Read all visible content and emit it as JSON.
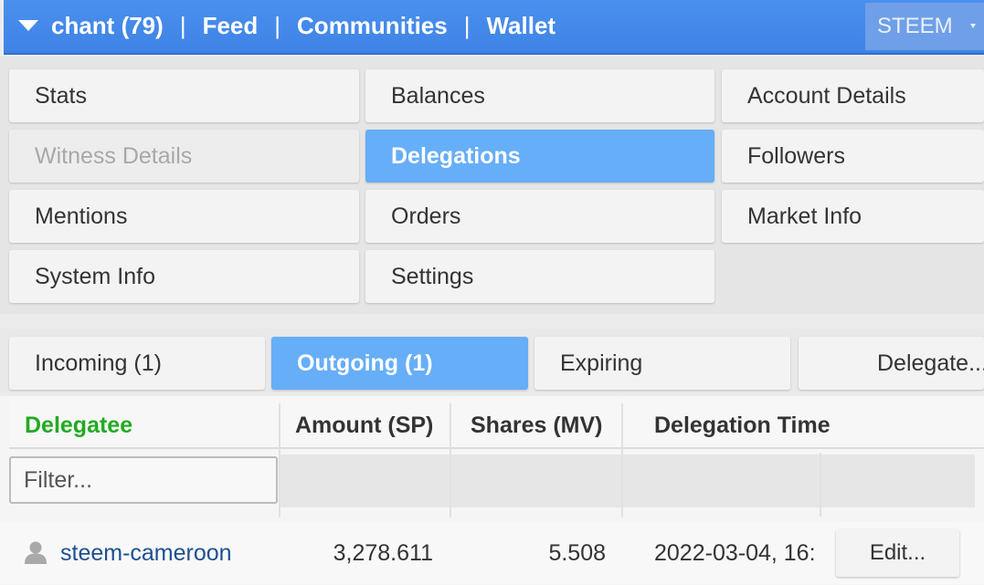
{
  "topbar": {
    "nav": {
      "account": "chant (79)",
      "feed": "Feed",
      "communities": "Communities",
      "wallet": "Wallet",
      "separator": "|"
    },
    "currency": "STEEM"
  },
  "menu": {
    "stats": "Stats",
    "balances": "Balances",
    "account_details": "Account Details",
    "witness_details": "Witness Details",
    "delegations": "Delegations",
    "followers": "Followers",
    "mentions": "Mentions",
    "orders": "Orders",
    "market_info": "Market Info",
    "system_info": "System Info",
    "settings": "Settings"
  },
  "subtabs": {
    "incoming": "Incoming (1)",
    "outgoing": "Outgoing (1)",
    "expiring": "Expiring",
    "delegate": "Delegate..."
  },
  "table": {
    "headers": {
      "delegatee": "Delegatee",
      "amount": "Amount (SP)",
      "shares": "Shares (MV)",
      "time": "Delegation Time"
    },
    "filter_placeholder": "Filter...",
    "rows": [
      {
        "delegatee": "steem-cameroon",
        "amount": "3,278.611",
        "shares": "5.508",
        "time": "2022-03-04, 16:",
        "action": "Edit..."
      }
    ]
  },
  "colors": {
    "topbar": "#4a90ee",
    "active": "#66aef8",
    "delegatee_header": "#22aa22",
    "link": "#1d4f91"
  },
  "icons": [
    "caret-down-icon",
    "dropdown-arrow-icon",
    "user-icon"
  ]
}
